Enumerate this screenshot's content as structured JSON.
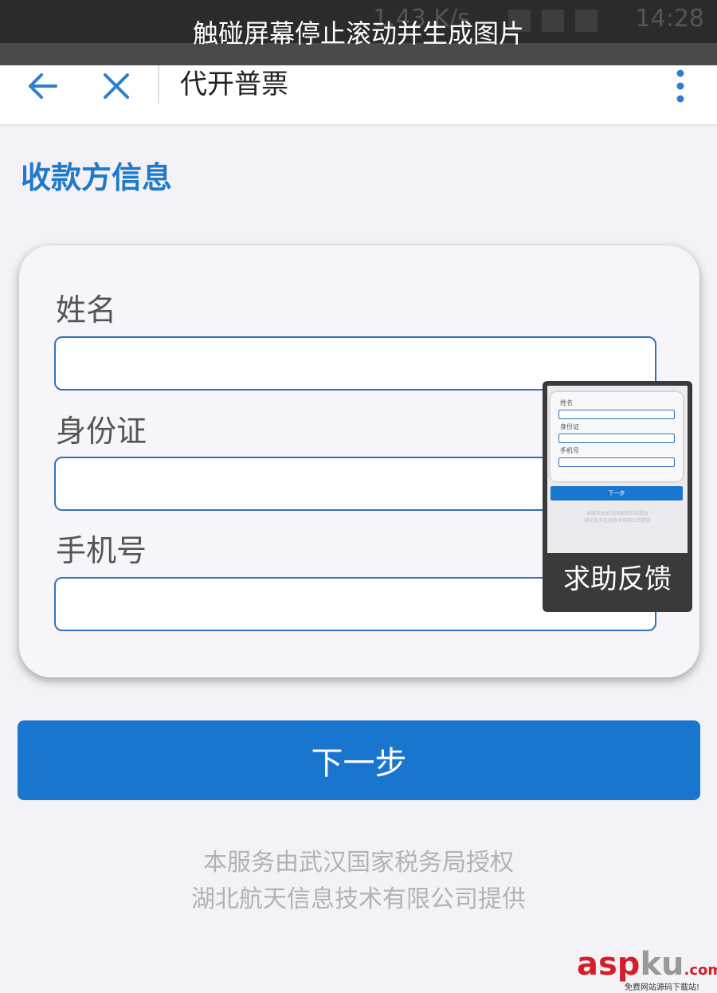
{
  "banner": {
    "text": "触碰屏幕停止滚动并生成图片",
    "status_speed": "1.43 K/s",
    "status_time": "14:28"
  },
  "nav": {
    "title": "代开普票",
    "back_icon": "arrow-left-icon",
    "close_icon": "close-icon",
    "more_icon": "more-vertical-icon",
    "accent_color": "#2d7fd0"
  },
  "section_title": "收款方信息",
  "form": {
    "fields": [
      {
        "label": "姓名",
        "value": ""
      },
      {
        "label": "身份证",
        "value": ""
      },
      {
        "label": "手机号",
        "value": ""
      }
    ]
  },
  "next_button": "下一步",
  "footer": {
    "line1": "本服务由武汉国家税务局授权",
    "line2": "湖北航天信息技术有限公司提供"
  },
  "feedback": {
    "label": "求助反馈",
    "thumb_fields": [
      "姓名",
      "身份证",
      "手机号"
    ],
    "thumb_button": "下一步"
  },
  "watermark": {
    "logo_main": "asp",
    "logo_ku": "ku",
    "logo_dot": ".com",
    "sub": "免费网站源码下载站!"
  },
  "colors": {
    "primary": "#1976cf",
    "title": "#1f7ac9",
    "background": "#f4f2f6"
  }
}
